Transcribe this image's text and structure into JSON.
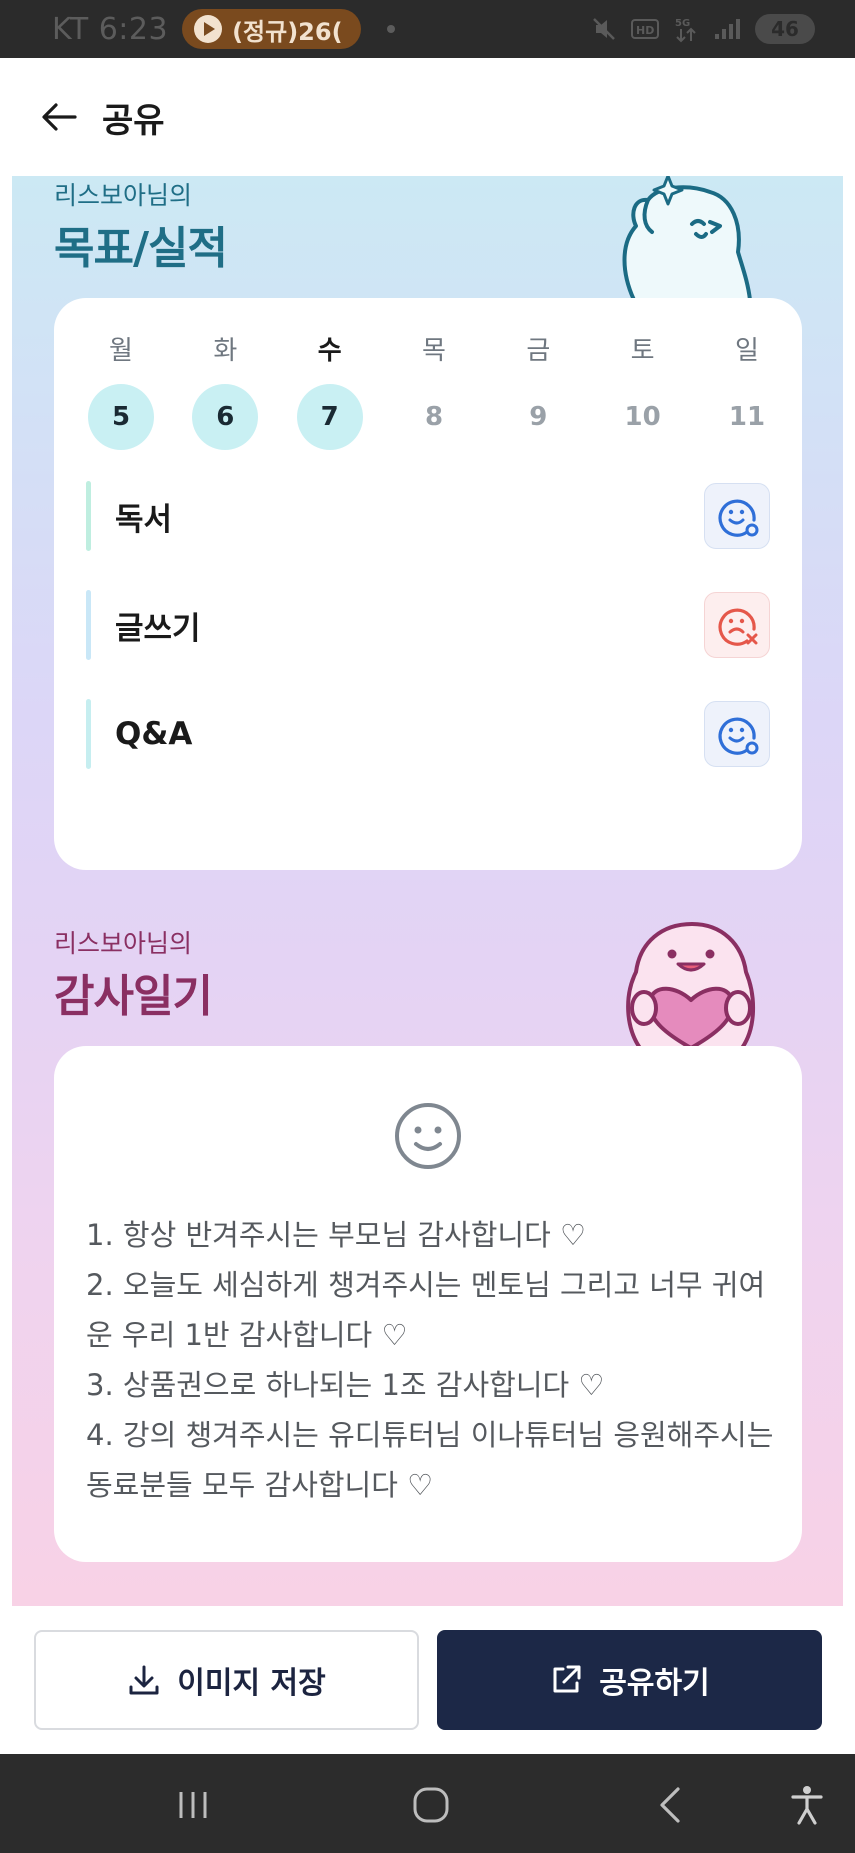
{
  "status_bar": {
    "carrier_time": "KT 6:23",
    "media_label": "(정규)26(",
    "battery": "46"
  },
  "header": {
    "title": "공유"
  },
  "goals_section": {
    "subtitle": "리스보아님의",
    "title": "목표/실적",
    "week": [
      {
        "day": "월",
        "date": "5",
        "active": true
      },
      {
        "day": "화",
        "date": "6",
        "active": true
      },
      {
        "day": "수",
        "date": "7",
        "active": true,
        "today": true
      },
      {
        "day": "목",
        "date": "8",
        "active": false
      },
      {
        "day": "금",
        "date": "9",
        "active": false
      },
      {
        "day": "토",
        "date": "10",
        "active": false
      },
      {
        "day": "일",
        "date": "11",
        "active": false
      }
    ],
    "items": [
      {
        "label": "독서",
        "status": "done",
        "bar_color": "#bfeee0"
      },
      {
        "label": "글쓰기",
        "status": "missed",
        "bar_color": "#c9e7f7"
      },
      {
        "label": "Q&A",
        "status": "done",
        "bar_color": "#c6eef0"
      }
    ],
    "colors": {
      "done": "#2f6fd8",
      "missed": "#e5574a"
    }
  },
  "gratitude_section": {
    "subtitle": "리스보아님의",
    "title": "감사일기",
    "text": "1. 항상 반겨주시는 부모님 감사합니다 ♡\n2. 오늘도 세심하게 챙겨주시는 멘토님 그리고 너무 귀여운 우리 1반 감사합니다 ♡\n3. 상품권으로 하나되는 1조 감사합니다 ♡\n4. 강의 챙겨주시는 유디튜터님 이나튜터님 응원해주시는 동료분들 모두 감사합니다 ♡"
  },
  "actions": {
    "save_label": "이미지 저장",
    "share_label": "공유하기"
  }
}
